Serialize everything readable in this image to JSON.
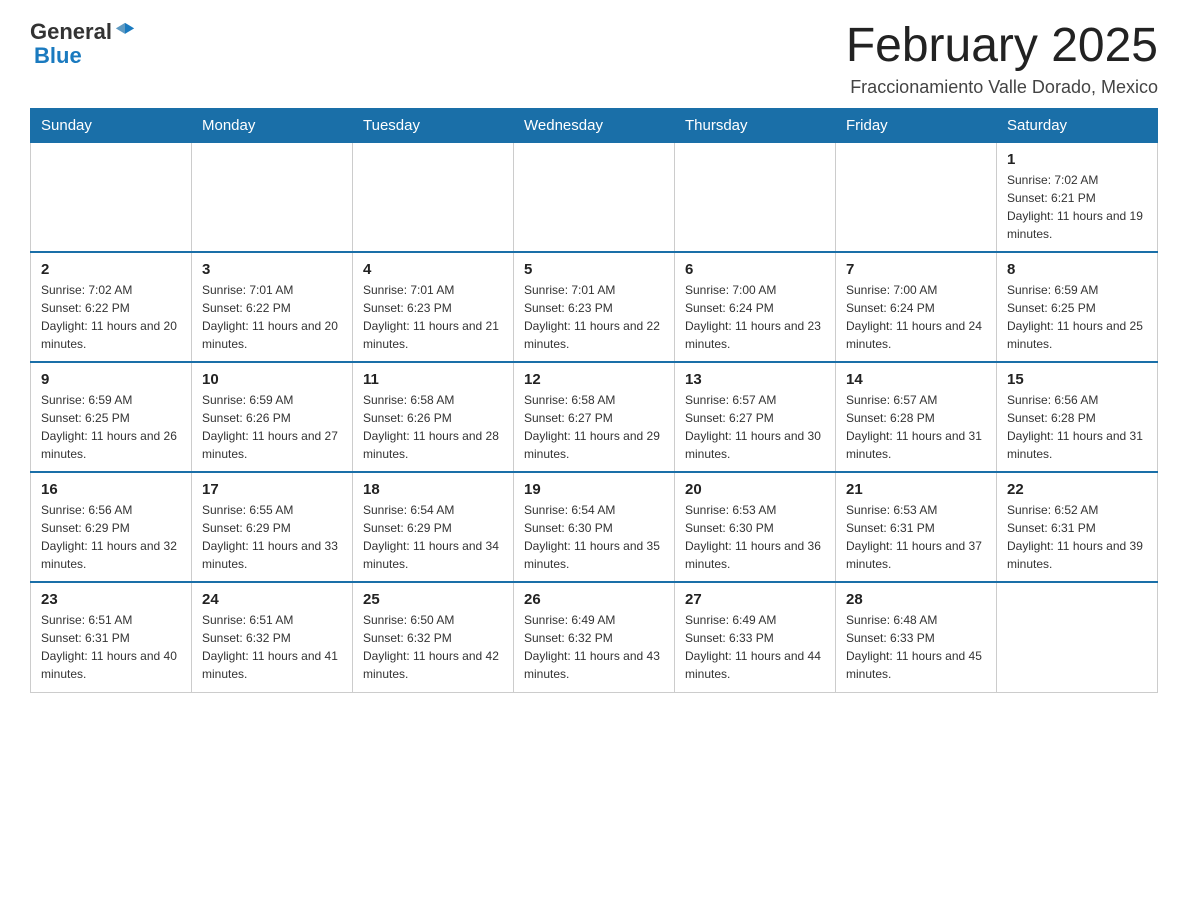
{
  "header": {
    "logo_general": "General",
    "logo_blue": "Blue",
    "title": "February 2025",
    "subtitle": "Fraccionamiento Valle Dorado, Mexico"
  },
  "weekdays": [
    "Sunday",
    "Monday",
    "Tuesday",
    "Wednesday",
    "Thursday",
    "Friday",
    "Saturday"
  ],
  "weeks": [
    {
      "days": [
        {
          "num": "",
          "info": ""
        },
        {
          "num": "",
          "info": ""
        },
        {
          "num": "",
          "info": ""
        },
        {
          "num": "",
          "info": ""
        },
        {
          "num": "",
          "info": ""
        },
        {
          "num": "",
          "info": ""
        },
        {
          "num": "1",
          "info": "Sunrise: 7:02 AM\nSunset: 6:21 PM\nDaylight: 11 hours and 19 minutes."
        }
      ]
    },
    {
      "days": [
        {
          "num": "2",
          "info": "Sunrise: 7:02 AM\nSunset: 6:22 PM\nDaylight: 11 hours and 20 minutes."
        },
        {
          "num": "3",
          "info": "Sunrise: 7:01 AM\nSunset: 6:22 PM\nDaylight: 11 hours and 20 minutes."
        },
        {
          "num": "4",
          "info": "Sunrise: 7:01 AM\nSunset: 6:23 PM\nDaylight: 11 hours and 21 minutes."
        },
        {
          "num": "5",
          "info": "Sunrise: 7:01 AM\nSunset: 6:23 PM\nDaylight: 11 hours and 22 minutes."
        },
        {
          "num": "6",
          "info": "Sunrise: 7:00 AM\nSunset: 6:24 PM\nDaylight: 11 hours and 23 minutes."
        },
        {
          "num": "7",
          "info": "Sunrise: 7:00 AM\nSunset: 6:24 PM\nDaylight: 11 hours and 24 minutes."
        },
        {
          "num": "8",
          "info": "Sunrise: 6:59 AM\nSunset: 6:25 PM\nDaylight: 11 hours and 25 minutes."
        }
      ]
    },
    {
      "days": [
        {
          "num": "9",
          "info": "Sunrise: 6:59 AM\nSunset: 6:25 PM\nDaylight: 11 hours and 26 minutes."
        },
        {
          "num": "10",
          "info": "Sunrise: 6:59 AM\nSunset: 6:26 PM\nDaylight: 11 hours and 27 minutes."
        },
        {
          "num": "11",
          "info": "Sunrise: 6:58 AM\nSunset: 6:26 PM\nDaylight: 11 hours and 28 minutes."
        },
        {
          "num": "12",
          "info": "Sunrise: 6:58 AM\nSunset: 6:27 PM\nDaylight: 11 hours and 29 minutes."
        },
        {
          "num": "13",
          "info": "Sunrise: 6:57 AM\nSunset: 6:27 PM\nDaylight: 11 hours and 30 minutes."
        },
        {
          "num": "14",
          "info": "Sunrise: 6:57 AM\nSunset: 6:28 PM\nDaylight: 11 hours and 31 minutes."
        },
        {
          "num": "15",
          "info": "Sunrise: 6:56 AM\nSunset: 6:28 PM\nDaylight: 11 hours and 31 minutes."
        }
      ]
    },
    {
      "days": [
        {
          "num": "16",
          "info": "Sunrise: 6:56 AM\nSunset: 6:29 PM\nDaylight: 11 hours and 32 minutes."
        },
        {
          "num": "17",
          "info": "Sunrise: 6:55 AM\nSunset: 6:29 PM\nDaylight: 11 hours and 33 minutes."
        },
        {
          "num": "18",
          "info": "Sunrise: 6:54 AM\nSunset: 6:29 PM\nDaylight: 11 hours and 34 minutes."
        },
        {
          "num": "19",
          "info": "Sunrise: 6:54 AM\nSunset: 6:30 PM\nDaylight: 11 hours and 35 minutes."
        },
        {
          "num": "20",
          "info": "Sunrise: 6:53 AM\nSunset: 6:30 PM\nDaylight: 11 hours and 36 minutes."
        },
        {
          "num": "21",
          "info": "Sunrise: 6:53 AM\nSunset: 6:31 PM\nDaylight: 11 hours and 37 minutes."
        },
        {
          "num": "22",
          "info": "Sunrise: 6:52 AM\nSunset: 6:31 PM\nDaylight: 11 hours and 39 minutes."
        }
      ]
    },
    {
      "days": [
        {
          "num": "23",
          "info": "Sunrise: 6:51 AM\nSunset: 6:31 PM\nDaylight: 11 hours and 40 minutes."
        },
        {
          "num": "24",
          "info": "Sunrise: 6:51 AM\nSunset: 6:32 PM\nDaylight: 11 hours and 41 minutes."
        },
        {
          "num": "25",
          "info": "Sunrise: 6:50 AM\nSunset: 6:32 PM\nDaylight: 11 hours and 42 minutes."
        },
        {
          "num": "26",
          "info": "Sunrise: 6:49 AM\nSunset: 6:32 PM\nDaylight: 11 hours and 43 minutes."
        },
        {
          "num": "27",
          "info": "Sunrise: 6:49 AM\nSunset: 6:33 PM\nDaylight: 11 hours and 44 minutes."
        },
        {
          "num": "28",
          "info": "Sunrise: 6:48 AM\nSunset: 6:33 PM\nDaylight: 11 hours and 45 minutes."
        },
        {
          "num": "",
          "info": ""
        }
      ]
    }
  ]
}
